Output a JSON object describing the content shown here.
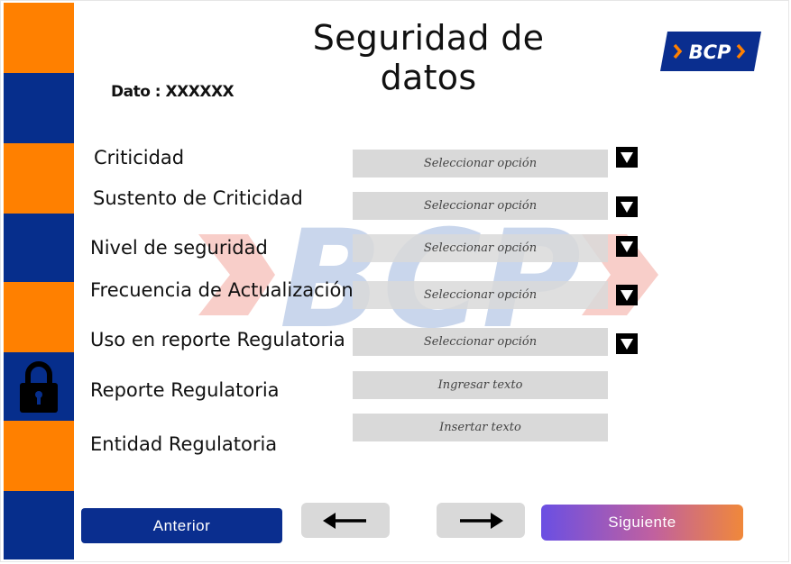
{
  "header": {
    "title": "Seguridad de datos",
    "logo_text": "BCP"
  },
  "dato": "Dato : XXXXXX",
  "watermark_text": "BCP",
  "form": {
    "rows": [
      {
        "label": "Criticidad",
        "placeholder": "Seleccionar opción",
        "type": "select"
      },
      {
        "label": "Sustento  de Criticidad",
        "placeholder": "Seleccionar opción",
        "type": "select"
      },
      {
        "label": "Nivel de seguridad",
        "placeholder": "Seleccionar opción",
        "type": "select"
      },
      {
        "label": "Frecuencia de Actualización",
        "placeholder": "Seleccionar opción",
        "type": "select"
      },
      {
        "label": "Uso en reporte Regulatoria",
        "placeholder": "Seleccionar opción",
        "type": "select"
      },
      {
        "label": "Reporte Regulatoria",
        "placeholder": "Ingresar texto",
        "type": "text"
      },
      {
        "label": "Entidad Regulatoria",
        "placeholder": "Insertar texto",
        "type": "text"
      }
    ]
  },
  "footer": {
    "anterior_label": "Anterior",
    "back_icon": "arrow-left-icon",
    "forward_icon": "arrow-right-icon",
    "siguiente_label": "Siguiente"
  },
  "colors": {
    "orange": "#ff8000",
    "navy": "#062e8c",
    "field_gray": "#d9d9d9"
  }
}
